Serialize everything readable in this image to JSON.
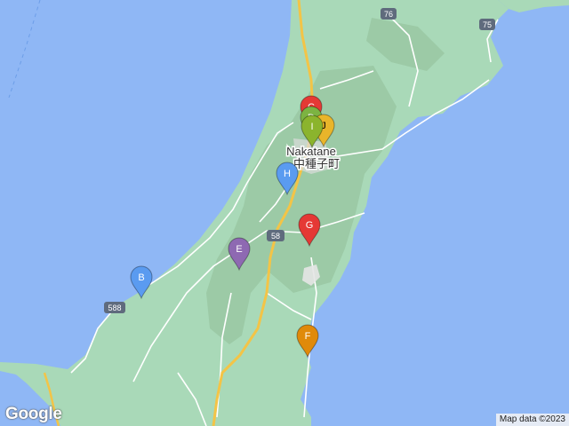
{
  "map": {
    "town_label_en": "Nakatane",
    "town_label_ja": "中種子町",
    "routes": [
      "76",
      "75",
      "58",
      "588"
    ],
    "colors": {
      "sea": "#8fb7f5",
      "land": "#a9d9b8",
      "terrain": "#9ccaa6",
      "road_major": "#f3c447",
      "road_minor": "#ffffff"
    }
  },
  "markers": [
    {
      "label": "C",
      "color": "#e53935"
    },
    {
      "label": "D",
      "color": "#7cb342"
    },
    {
      "label": "J",
      "color": "#e9b52a"
    },
    {
      "label": "I",
      "color": "#8bb42d"
    },
    {
      "label": "H",
      "color": "#5a9bf0"
    },
    {
      "label": "G",
      "color": "#e53935"
    },
    {
      "label": "E",
      "color": "#8e69b2"
    },
    {
      "label": "B",
      "color": "#5a9bf0"
    },
    {
      "label": "F",
      "color": "#e08a0a"
    }
  ],
  "attribution": "Map data ©2023",
  "logo": "Google"
}
